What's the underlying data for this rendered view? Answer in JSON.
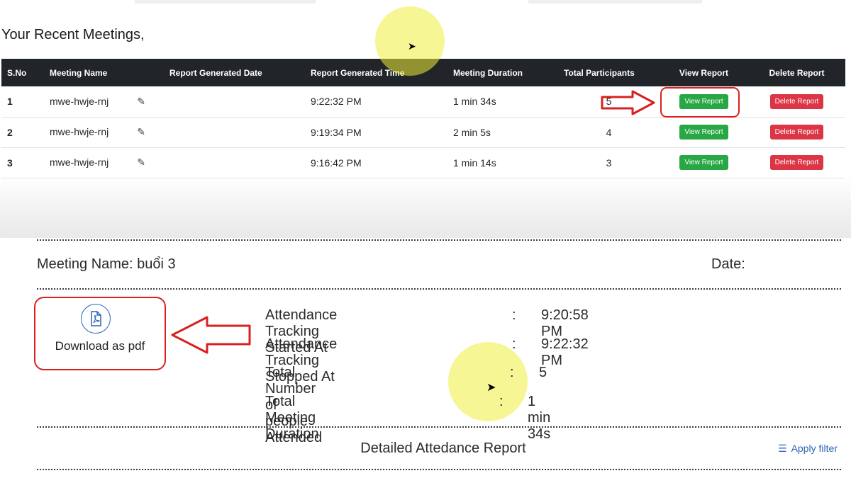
{
  "recent_heading": "Your Recent Meetings,",
  "table": {
    "headers": [
      "S.No",
      "Meeting Name",
      "Report Generated Date",
      "Report Generated Time",
      "Meeting Duration",
      "Total Participants",
      "View Report",
      "Delete Report"
    ],
    "rows": [
      {
        "sno": "1",
        "name": "mwe-hwje-rnj",
        "date": "",
        "time": "9:22:32 PM",
        "duration": "1 min 34s",
        "participants": "5",
        "view": "View Report",
        "delete": "Delete Report"
      },
      {
        "sno": "2",
        "name": "mwe-hwje-rnj",
        "date": "",
        "time": "9:19:34 PM",
        "duration": "2 min 5s",
        "participants": "4",
        "view": "View Report",
        "delete": "Delete Report"
      },
      {
        "sno": "3",
        "name": "mwe-hwje-rnj",
        "date": "",
        "time": "9:16:42 PM",
        "duration": "1 min 14s",
        "participants": "3",
        "view": "View Report",
        "delete": "Delete Report"
      }
    ]
  },
  "report": {
    "meeting_name_label": "Meeting Name:  buổi 3",
    "date_label": "Date:",
    "download_label": "Download as pdf",
    "rows": [
      {
        "label": "Attendance Tracking Started At",
        "colon": ":",
        "value": "9:20:58 PM"
      },
      {
        "label": "Attendance Tracking Stopped At",
        "colon": ":",
        "value": "9:22:32 PM"
      },
      {
        "label": "Total Number of people Attended",
        "colon": ":",
        "value": "5"
      },
      {
        "label": "Total Meeting Duration",
        "colon": ":",
        "value": "1 min 34s"
      }
    ],
    "detailed_title": "Detailed Attedance Report",
    "apply_filter": "Apply filter"
  },
  "colors": {
    "annotation_red": "#d9201f",
    "highlight_yellow": "#eeee3c",
    "header_dark": "#212529",
    "button_green": "#28a745",
    "button_red": "#dc3545",
    "link_blue": "#2c63b5"
  },
  "icons": {
    "pencil": "pencil-icon",
    "pdf": "pdf-file-icon",
    "filter": "filter-icon",
    "cursor": "mouse-cursor-icon"
  }
}
